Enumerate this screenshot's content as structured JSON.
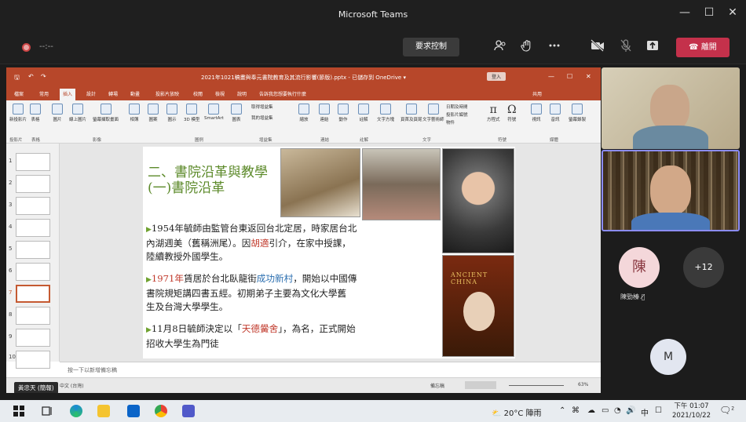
{
  "window": {
    "title": "Microsoft Teams",
    "minimize": "—",
    "maximize": "☐",
    "close": "✕"
  },
  "meeting": {
    "timer": "--:--",
    "request_control": "要求控制",
    "leave": "離開",
    "icons": [
      "participants-icon",
      "reactions-icon",
      "more-icon",
      "camera-off-icon",
      "mic-off-icon",
      "share-icon"
    ]
  },
  "powerpoint": {
    "title": "2021年1021稿畫與奉元書院教育及其流行影響(節版).pptx - 已儲存到 OneDrive ▾",
    "tabs": [
      "檔案",
      "常用",
      "插入",
      "設計",
      "轉場",
      "動畫",
      "投影片放映",
      "校閱",
      "檢視",
      "說明",
      "告訴我您想要執行什麼"
    ],
    "active_tab": "插入",
    "share_label": "共用",
    "ribbon_items": [
      "新投影片",
      "表格",
      "圖片",
      "線上圖片",
      "螢幕擷取畫面",
      "相簿",
      "圖案",
      "圖示",
      "3D 模型",
      "SmartArt",
      "圖表",
      "取得增益集",
      "我的增益集",
      "縮放",
      "連結",
      "動作",
      "註解",
      "文字方塊",
      "頁首及頁尾",
      "文字藝術師",
      "日期及時間",
      "投影片編號",
      "物件",
      "方程式",
      "符號",
      "視訊",
      "音訊",
      "螢幕錄製"
    ],
    "ribbon_groups": [
      "投影片",
      "表格",
      "影像",
      "圖例",
      "增益集",
      "連結",
      "註解",
      "文字",
      "符號",
      "媒體"
    ],
    "slide_numbers": [
      "1",
      "2",
      "3",
      "4",
      "5",
      "6",
      "7",
      "8",
      "9",
      "10"
    ],
    "selected_slide": 7,
    "notes_placeholder": "按一下以新增備忘稿",
    "status_lang": "中文 (台灣)",
    "status_notes": "備忘稿",
    "zoom": "63%",
    "presenter": "黃忠天 (簡報)"
  },
  "slide": {
    "title1": "二、書院沿革與教學",
    "title2": "(一)書院沿革",
    "p1_a": "1954年毓師由監管台東返回台北定居，時家居台北",
    "p1_b": "內湖週美（舊稱洲尾）。因",
    "p1_hl": "胡適",
    "p1_c": "引介，在家中授課，",
    "p1_d": "陸續教授外國學生。",
    "p2_hl1": "1971年",
    "p2_a": "賃居於台北臥龍街",
    "p2_hl2": "成功新村",
    "p2_b": "，開始以中國傳",
    "p2_c": "書院規矩講四書五經。初期弟子主要為文化大學舊",
    "p2_d": "生及台灣大學學生。",
    "p3_a": "11月8日毓師決定以「",
    "p3_hl": "天德黌舍",
    "p3_b": "」，為名，正式開始",
    "p3_c": "招收大學生為門徒",
    "book_text": "ANCIENT CHINA"
  },
  "participants": {
    "chen_initial": "陳",
    "chen_name": "陳勁榛",
    "more": "+12",
    "m_initial": "M"
  },
  "taskbar": {
    "weather": "20°C 陣雨",
    "ime": "中",
    "time": "下午 01:07",
    "date": "2021/10/22",
    "notif_count": "2"
  }
}
